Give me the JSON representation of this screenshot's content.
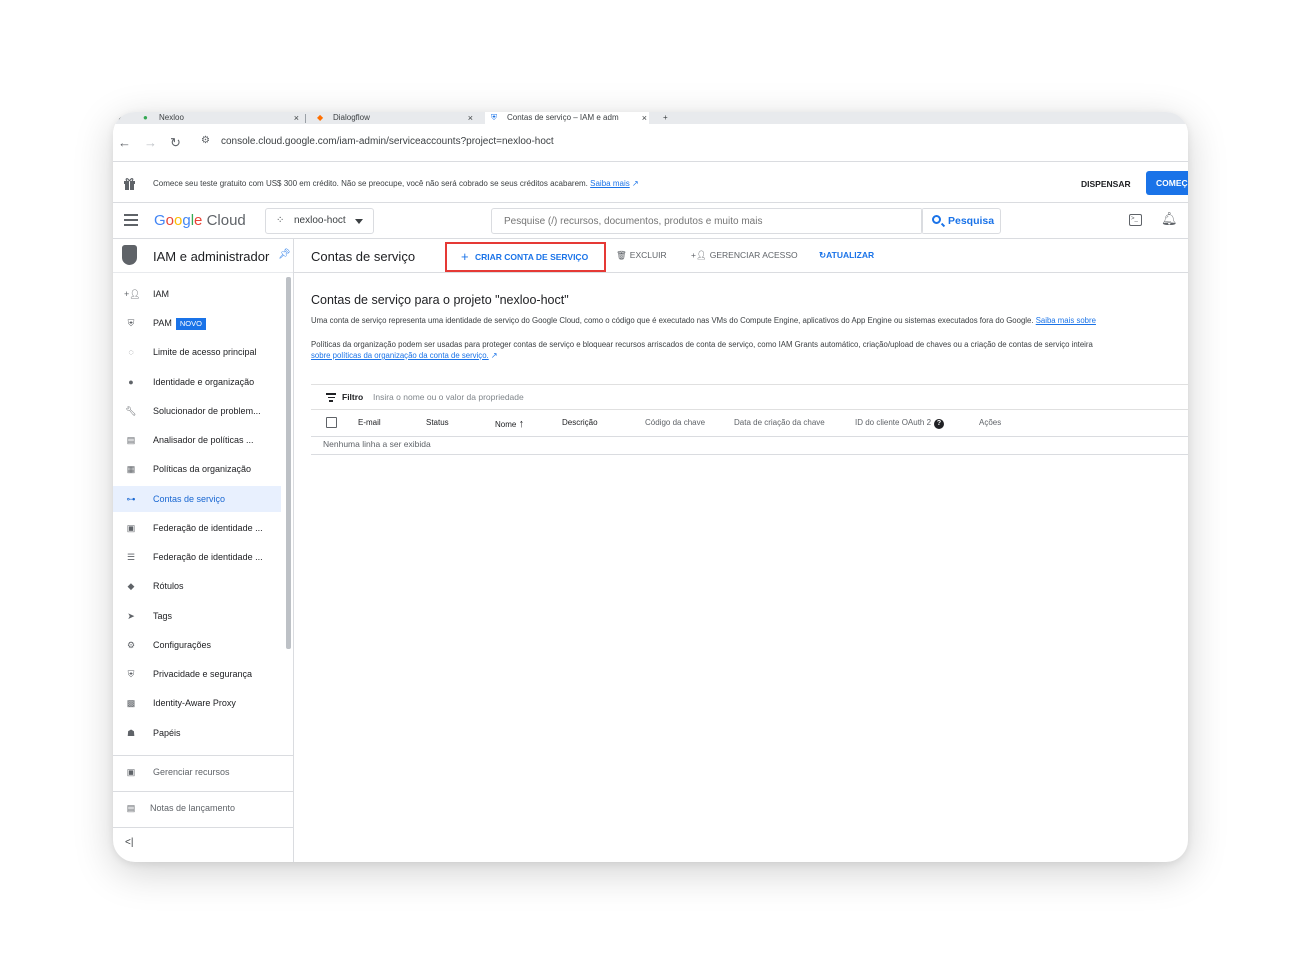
{
  "browser": {
    "tabs": [
      {
        "title": "Nexloo"
      },
      {
        "title": "Dialogflow"
      },
      {
        "title": "Contas de serviço – IAM e adm"
      }
    ],
    "new_tab": "+",
    "url": "console.cloud.google.com/iam-admin/serviceaccounts?project=nexloo-hoct"
  },
  "promo": {
    "text": "Comece seu teste gratuito com US$ 300 em crédito. Não se preocupe, você não será cobrado se seus créditos acabarem.",
    "link": "Saiba mais",
    "dismiss": "DISPENSAR",
    "start": "COMEÇ"
  },
  "header": {
    "logo": "Google Cloud",
    "project": "nexloo-hoct",
    "search_placeholder": "Pesquise (/) recursos, documentos, produtos e muito mais",
    "search_button": "Pesquisa"
  },
  "sidebar": {
    "title": "IAM e administrador",
    "items": [
      {
        "label": "IAM",
        "icon": "person-add-icon"
      },
      {
        "label": "PAM",
        "icon": "shield-lock-icon",
        "badge": "NOVO"
      },
      {
        "label": "Limite de acesso principal",
        "icon": "policy-icon"
      },
      {
        "label": "Identidade e organização",
        "icon": "account-circle-icon"
      },
      {
        "label": "Solucionador de problem...",
        "icon": "wrench-icon"
      },
      {
        "label": "Analisador de políticas ...",
        "icon": "policy-search-icon"
      },
      {
        "label": "Políticas da organização",
        "icon": "document-icon"
      },
      {
        "label": "Contas de serviço",
        "icon": "service-account-icon"
      },
      {
        "label": "Federação de identidade ...",
        "icon": "badge-icon"
      },
      {
        "label": "Federação de identidade ...",
        "icon": "list-icon"
      },
      {
        "label": "Rótulos",
        "icon": "label-icon"
      },
      {
        "label": "Tags",
        "icon": "tag-icon"
      },
      {
        "label": "Configurações",
        "icon": "gear-icon"
      },
      {
        "label": "Privacidade e segurança",
        "icon": "shield-icon"
      },
      {
        "label": "Identity-Aware Proxy",
        "icon": "proxy-icon"
      },
      {
        "label": "Papéis",
        "icon": "roles-icon"
      }
    ],
    "manage_resources": "Gerenciar recursos",
    "release_notes": "Notas de lançamento",
    "collapse": "<|"
  },
  "main": {
    "title": "Contas de serviço",
    "actions": {
      "create": "CRIAR CONTA DE SERVIÇO",
      "delete": "EXCLUIR",
      "manage_access": "GERENCIAR ACESSO",
      "refresh": "ATUALIZAR"
    },
    "heading": "Contas de serviço para o projeto \"nexloo-hoct\"",
    "desc1": "Uma conta de serviço representa uma identidade de serviço do Google Cloud, como o código que é executado nas VMs do Compute Engine, aplicativos do App Engine ou sistemas executados fora do Google.",
    "desc1_link": "Saiba mais sobre",
    "desc2": "Políticas da organização podem ser usadas para proteger contas de serviço e bloquear recursos arriscados de conta de serviço, como IAM Grants automático, criação/upload de chaves ou a criação de contas de serviço inteira",
    "desc2_link": "sobre políticas da organização da conta de serviço.",
    "filter_label": "Filtro",
    "filter_placeholder": "Insira o nome ou o valor da propriedade",
    "columns": [
      "E-mail",
      "Status",
      "Nome",
      "Descrição",
      "Código da chave",
      "Data de criação da chave",
      "ID do cliente OAuth 2",
      "Ações"
    ],
    "empty": "Nenhuma linha a ser exibida"
  },
  "colors": {
    "accent": "#1a73e8",
    "highlight_border": "#e53935",
    "active_bg": "#e8f0fe"
  }
}
